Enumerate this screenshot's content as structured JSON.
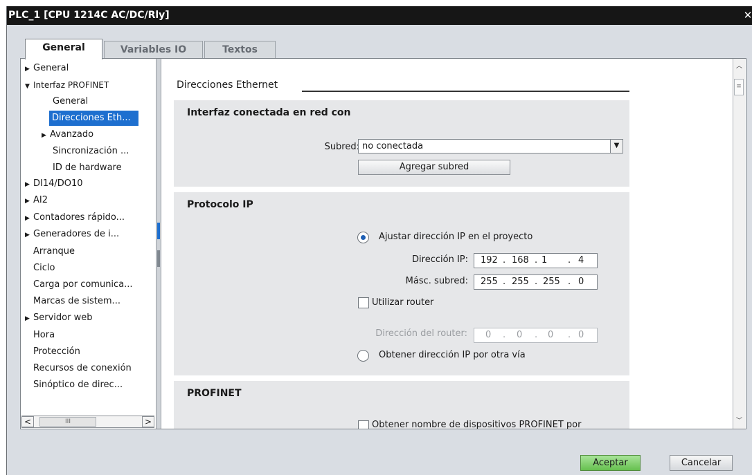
{
  "window": {
    "title": "PLC_1 [CPU 1214C AC/DC/Rly]",
    "close_glyph": "✕"
  },
  "tabs": [
    {
      "label": "General"
    },
    {
      "label": "Variables IO"
    },
    {
      "label": "Textos"
    }
  ],
  "tree": {
    "items": [
      {
        "label": "General",
        "arrow": "▶"
      },
      {
        "label": "Interfaz PROFINET",
        "arrow": "▼"
      },
      {
        "label": "General"
      },
      {
        "label": "Direcciones Eth..."
      },
      {
        "label": "Avanzado",
        "arrow": "▶"
      },
      {
        "label": "Sincronización ..."
      },
      {
        "label": "ID de hardware"
      },
      {
        "label": "DI14/DO10",
        "arrow": "▶"
      },
      {
        "label": "AI2",
        "arrow": "▶"
      },
      {
        "label": "Contadores rápido...",
        "arrow": "▶"
      },
      {
        "label": "Generadores de i...",
        "arrow": "▶"
      },
      {
        "label": "Arranque"
      },
      {
        "label": "Ciclo"
      },
      {
        "label": "Carga por comunica..."
      },
      {
        "label": "Marcas de sistem..."
      },
      {
        "label": "Servidor web",
        "arrow": "▶"
      },
      {
        "label": "Hora"
      },
      {
        "label": "Protección"
      },
      {
        "label": "Recursos de conexión"
      },
      {
        "label": "Sinóptico de direc..."
      }
    ],
    "scroll_left": "<",
    "scroll_right": ">",
    "scroll_thumb": "III"
  },
  "panel": {
    "section_title": "Direcciones Ethernet",
    "network": {
      "title": "Interfaz conectada en red con",
      "subnet_label": "Subred:",
      "subnet_value": "no conectada",
      "add_subnet_button": "Agregar subred"
    },
    "ip_protocol": {
      "title": "Protocolo IP",
      "set_ip_option": "Ajustar dirección IP en el proyecto",
      "ip_label": "Dirección IP:",
      "ip_octets": [
        "192",
        "168",
        "1",
        "4"
      ],
      "mask_label": "Másc. subred:",
      "mask_octets": [
        "255",
        "255",
        "255",
        "0"
      ],
      "router_checkbox": "Utilizar router",
      "router_label": "Dirección del router:",
      "router_octets": [
        "0",
        "0",
        "0",
        "0"
      ],
      "other_ip_option": "Obtener dirección IP por otra vía"
    },
    "profinet": {
      "title": "PROFINET",
      "device_name_checkbox": "Obtener nombre de dispositivos PROFINET por"
    }
  },
  "footer": {
    "ok": "Aceptar",
    "cancel": "Cancelar"
  },
  "colors": {
    "selection": "#1e6fcf",
    "ok_button": "#66c04f",
    "titlebar": "#161616"
  }
}
